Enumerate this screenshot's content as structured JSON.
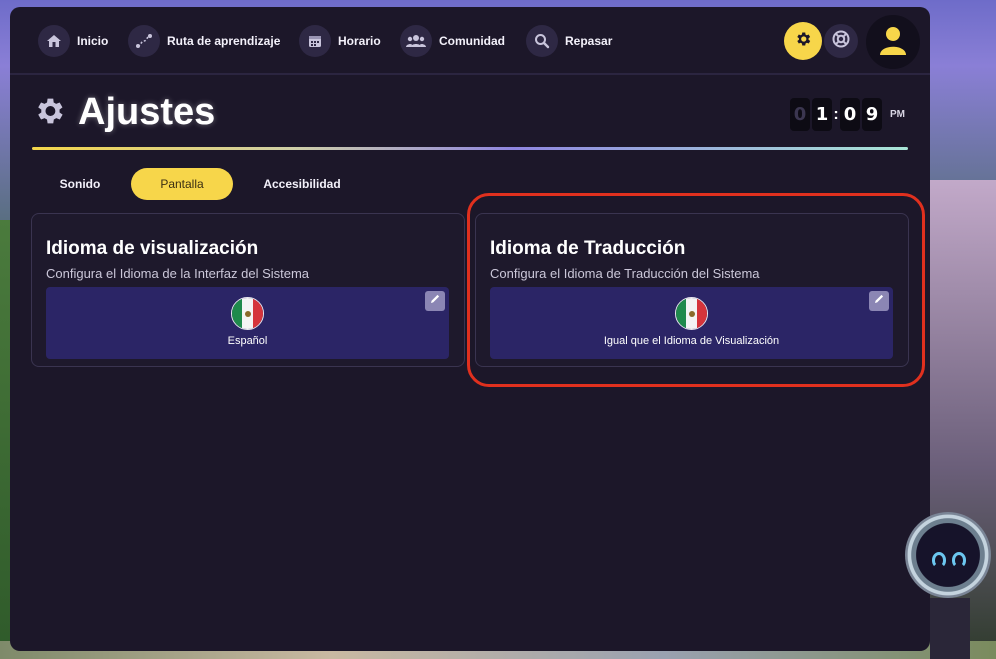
{
  "nav": {
    "items": [
      {
        "label": "Inicio",
        "icon": "home-icon"
      },
      {
        "label": "Ruta de aprendizaje",
        "icon": "learning-path-icon"
      },
      {
        "label": "Horario",
        "icon": "calendar-icon"
      },
      {
        "label": "Comunidad",
        "icon": "community-icon"
      },
      {
        "label": "Repasar",
        "icon": "review-search-icon"
      }
    ],
    "settings_icon": "gear-icon",
    "help_icon": "lifebuoy-icon",
    "avatar_icon": "user-avatar-icon"
  },
  "header": {
    "title": "Ajustes",
    "clock": {
      "d1": "0",
      "d2": "1",
      "d3": "0",
      "d4": "9",
      "ampm": "PM"
    }
  },
  "tabs": [
    {
      "label": "Sonido",
      "active": false
    },
    {
      "label": "Pantalla",
      "active": true
    },
    {
      "label": "Accesibilidad",
      "active": false
    }
  ],
  "cards": {
    "display_language": {
      "title": "Idioma de visualización",
      "subtitle": "Configura el Idioma de la Interfaz del Sistema",
      "value": "Español",
      "flag": "mexico-flag-icon"
    },
    "translation_language": {
      "title": "Idioma de Traducción",
      "subtitle": "Configura el Idioma de Traducción del Sistema",
      "value": "Igual que el Idioma de Visualización",
      "flag": "mexico-flag-icon"
    }
  },
  "colors": {
    "accent": "#f7d64a",
    "panel_bg": "#1c1729",
    "lang_box": "#2b2566",
    "highlight": "#e0301e"
  }
}
